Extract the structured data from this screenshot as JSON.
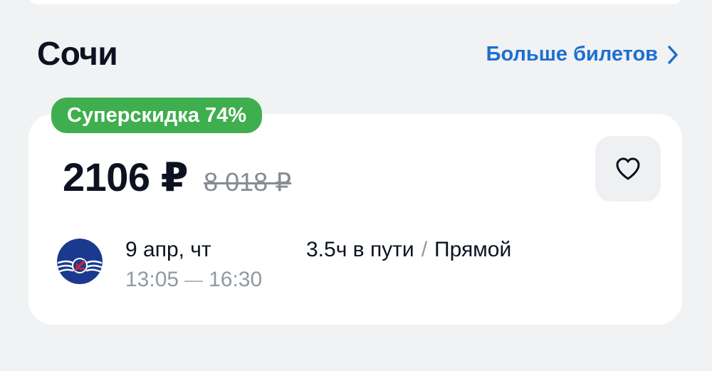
{
  "section": {
    "city": "Сочи",
    "more_link": "Больше билетов"
  },
  "offer": {
    "badge": "Суперскидка 74%",
    "price": "2106 ₽",
    "old_price": "8 018 ₽",
    "date": "9 апр, чт",
    "departure_time": "13:05",
    "arrival_time": "16:30",
    "duration": "3.5ч в пути",
    "separator": "/",
    "route_type": "Прямой",
    "airline_logo": "aeroflot-logo"
  },
  "colors": {
    "accent": "#1d6fd0",
    "badge": "#3fae4e",
    "logo_blue": "#1b3a8f"
  }
}
